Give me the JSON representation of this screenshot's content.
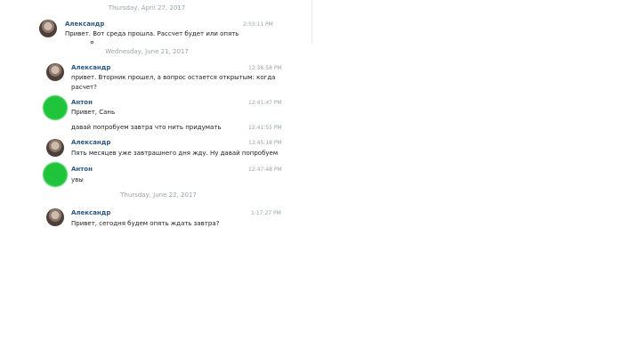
{
  "top_panel": {
    "date": "Thursday, April 27, 2017",
    "message": {
      "sender": "Александр",
      "time": "2:53:11 PM",
      "text": "Привет. Вот среда прошла. Рассчет будет или опять",
      "cut_text": "я"
    }
  },
  "chat": {
    "groups": [
      {
        "date": "Wednesday, June 21, 2017",
        "messages": [
          {
            "sender": "Александр",
            "time": "12:36:58 PM",
            "text": "привет. Вторник прошел, а вопрос остается открытым: когда расчет?"
          },
          {
            "sender": "Антон",
            "time": "12:41:47 PM",
            "text": "Привет, Сань"
          },
          {
            "sender": "",
            "time": "12:41:55 PM",
            "text": "давай попробуем завтра что нить придумать"
          },
          {
            "sender": "Александр",
            "time": "12:45:18 PM",
            "text": "Пять месяцев уже завтрашнего дня жду. Ну давай попробуем"
          },
          {
            "sender": "Антон",
            "time": "12:47:48 PM",
            "text": "увы"
          }
        ]
      },
      {
        "date": "Thursday, June 22, 2017",
        "messages": [
          {
            "sender": "Александр",
            "time": "1:17:27 PM",
            "text": "Привет, сегодня будем опять ждать завтра?"
          }
        ]
      }
    ]
  }
}
